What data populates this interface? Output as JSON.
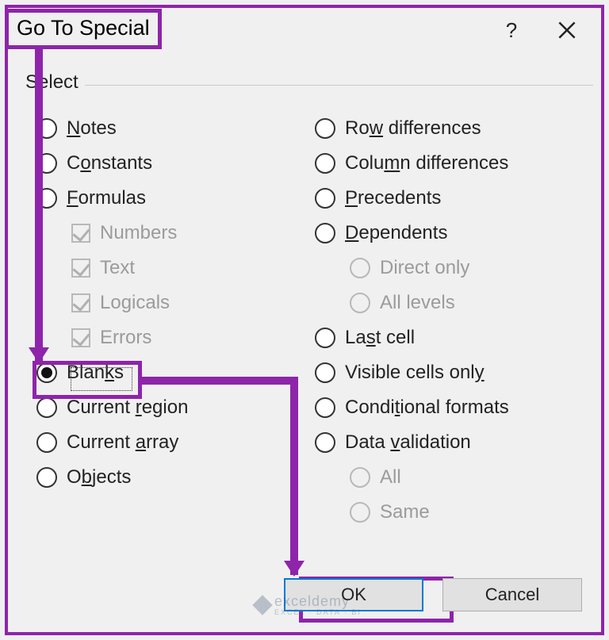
{
  "dialog": {
    "title": "Go To Special",
    "help_tooltip": "?",
    "group_label": "Select",
    "left_options": [
      {
        "id": "notes",
        "pre": "",
        "u": "N",
        "post": "otes",
        "selected": false
      },
      {
        "id": "constants",
        "pre": "C",
        "u": "o",
        "post": "nstants",
        "selected": false
      },
      {
        "id": "formulas",
        "pre": "",
        "u": "F",
        "post": "ormulas",
        "selected": false
      }
    ],
    "formula_subchecks": [
      {
        "id": "numbers",
        "label": "Numbers"
      },
      {
        "id": "text",
        "label": "Text"
      },
      {
        "id": "logicals",
        "label": "Logicals"
      },
      {
        "id": "errors",
        "label": "Errors"
      }
    ],
    "left_options2": [
      {
        "id": "blanks",
        "pre": "Blan",
        "u": "k",
        "post": "s",
        "selected": true
      },
      {
        "id": "current-region",
        "pre": "Current ",
        "u": "r",
        "post": "egion",
        "selected": false
      },
      {
        "id": "current-array",
        "pre": "Current ",
        "u": "a",
        "post": "rray",
        "selected": false
      },
      {
        "id": "objects",
        "pre": "O",
        "u": "b",
        "post": "jects",
        "selected": false
      }
    ],
    "right_options": [
      {
        "id": "row-diff",
        "pre": "Ro",
        "u": "w",
        "post": " differences",
        "selected": false
      },
      {
        "id": "col-diff",
        "pre": "Colu",
        "u": "m",
        "post": "n differences",
        "selected": false
      },
      {
        "id": "precedents",
        "pre": "",
        "u": "P",
        "post": "recedents",
        "selected": false
      },
      {
        "id": "dependents",
        "pre": "",
        "u": "D",
        "post": "ependents",
        "selected": false
      }
    ],
    "dep_subradios": [
      {
        "id": "direct",
        "label": "Direct only"
      },
      {
        "id": "all-levels",
        "label": "All levels"
      }
    ],
    "right_options2": [
      {
        "id": "last-cell",
        "pre": "La",
        "u": "s",
        "post": "t cell",
        "selected": false
      },
      {
        "id": "visible",
        "pre": "Visible cells onl",
        "u": "y",
        "post": "",
        "selected": false
      },
      {
        "id": "cond-formats",
        "pre": "Condi",
        "u": "t",
        "post": "ional formats",
        "selected": false
      },
      {
        "id": "data-validation",
        "pre": "Data ",
        "u": "v",
        "post": "alidation",
        "selected": false
      }
    ],
    "dv_subradios": [
      {
        "id": "dv-all",
        "label": "All"
      },
      {
        "id": "dv-same",
        "label": "Same"
      }
    ],
    "buttons": {
      "ok": "OK",
      "cancel": "Cancel"
    }
  },
  "watermark": {
    "brand": "exceldemy",
    "tag": "EXCEL · DATA · BI"
  },
  "annotation": {
    "highlight_color": "#8e24aa",
    "highlighted": [
      "title",
      "blanks",
      "ok"
    ]
  }
}
